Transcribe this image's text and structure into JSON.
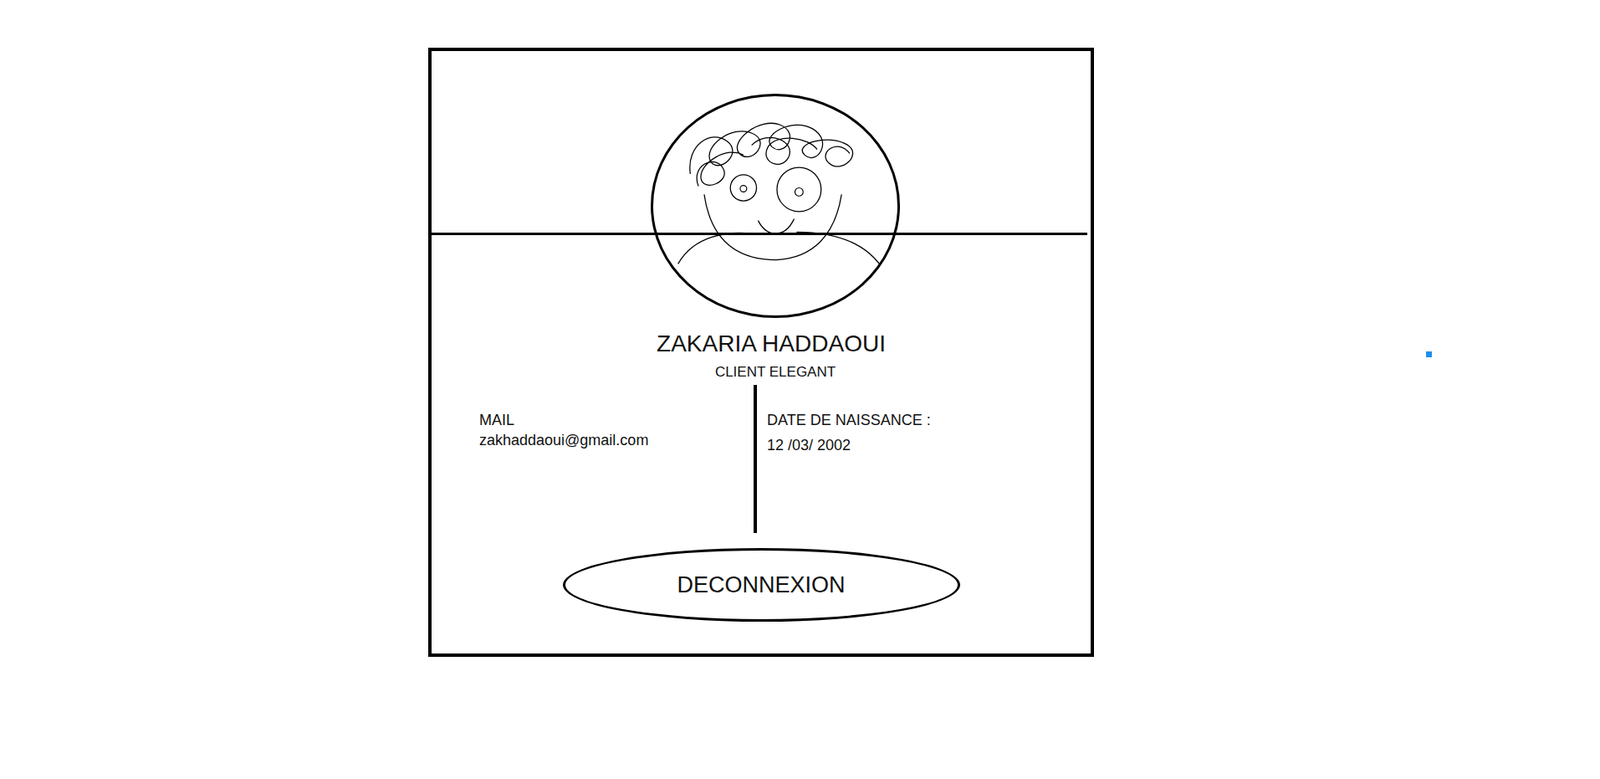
{
  "profile": {
    "name": "ZAKARIA HADDAOUI",
    "role": "CLIENT ELEGANT"
  },
  "fields": [
    {
      "label": "MAIL",
      "value": "zakhaddaoui@gmail.com"
    },
    {
      "label": "DATE DE NAISSANCE :",
      "value": "12 /03/ 2002"
    }
  ],
  "buttons": [
    "DECONNEXION"
  ]
}
